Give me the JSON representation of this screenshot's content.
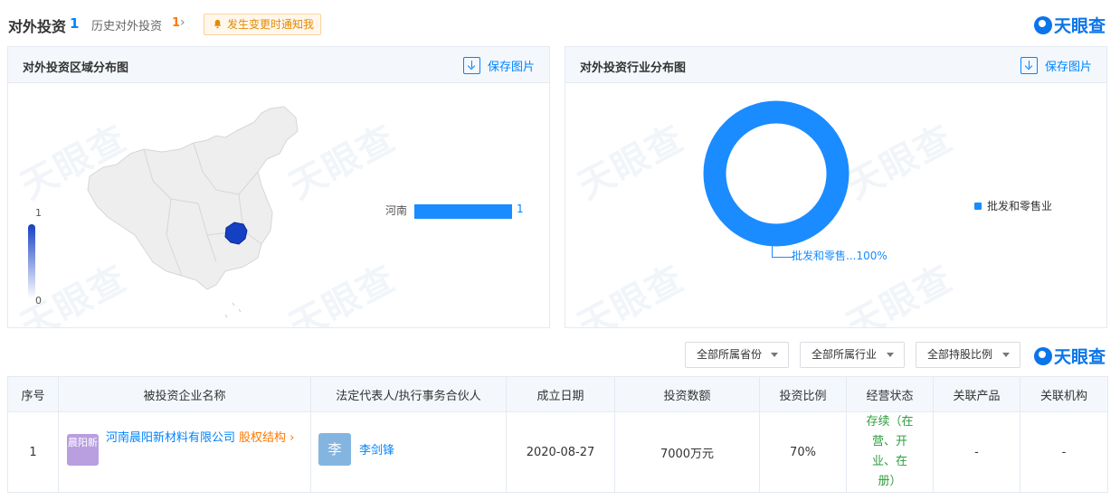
{
  "header": {
    "title": "对外投资",
    "title_count": "1",
    "history_label": "历史对外投资",
    "history_count": "1",
    "notify_label": "发生变更时通知我",
    "brand": "天眼查"
  },
  "watermark": {
    "text": "天眼查"
  },
  "region_panel": {
    "title": "对外投资区域分布图",
    "save_label": "保存图片",
    "legend_max": "1",
    "legend_min": "0"
  },
  "industry_panel": {
    "title": "对外投资行业分布图",
    "save_label": "保存图片",
    "slice_label": "批发和零售...100%",
    "legend_label": "批发和零售业"
  },
  "chart_data": [
    {
      "type": "bar",
      "categories": [
        "河南"
      ],
      "values": [
        1
      ],
      "visual_map_range": [
        0,
        1
      ]
    },
    {
      "type": "pie",
      "labels": [
        "批发和零售业"
      ],
      "values": [
        100
      ],
      "colors": [
        "#1a8cff"
      ]
    }
  ],
  "filters": {
    "province": "全部所属省份",
    "industry": "全部所属行业",
    "share_ratio": "全部持股比例"
  },
  "table": {
    "columns": [
      "序号",
      "被投资企业名称",
      "法定代表人/执行事务合伙人",
      "成立日期",
      "投资数额",
      "投资比例",
      "经营状态",
      "关联产品",
      "关联机构"
    ],
    "rows": [
      {
        "index": "1",
        "logo_text": "晨阳新",
        "company": "河南晨阳新材料有限公司",
        "equity_link": "股权结构",
        "rep_avatar": "李",
        "rep_name": "李剑锋",
        "founded": "2020-08-27",
        "amount": "7000万元",
        "ratio": "70%",
        "status": "存续（在营、开业、在册）",
        "products": "-",
        "institutions": "-"
      }
    ]
  },
  "colors": {
    "accent": "#0084ff",
    "map_highlight": "#1540c4",
    "status_green": "#2e9d3e",
    "orange": "#ff7800"
  }
}
